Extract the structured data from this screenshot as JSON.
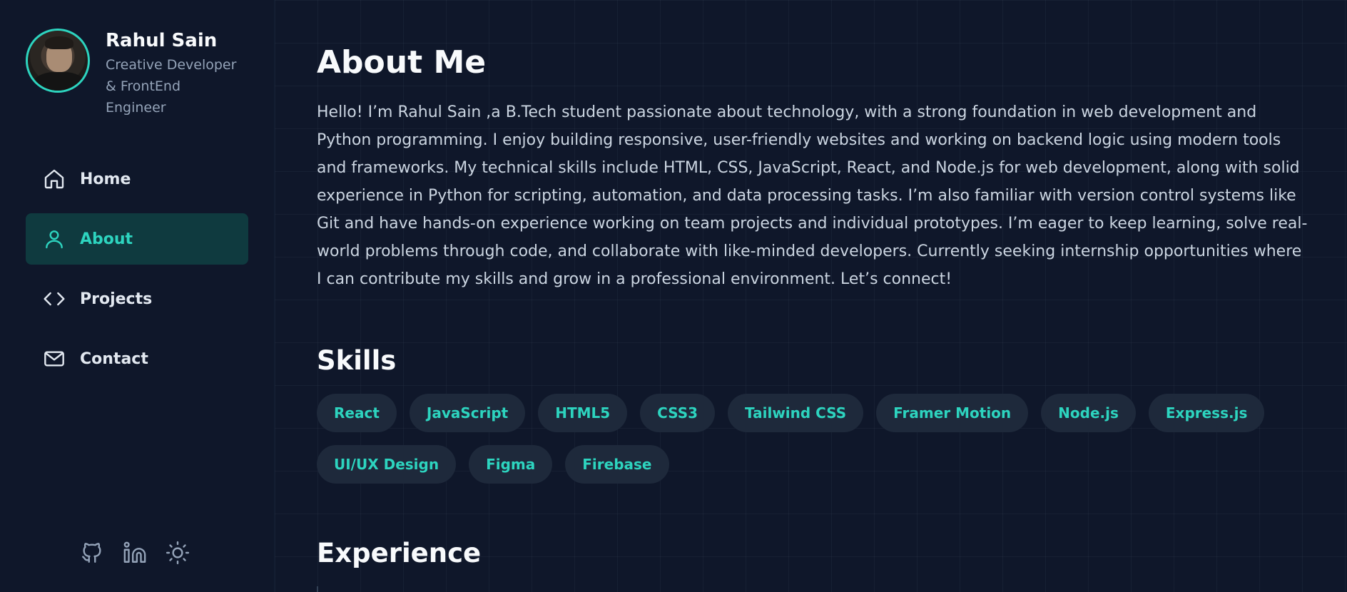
{
  "profile": {
    "name": "Rahul Sain",
    "role": "Creative Developer & FrontEnd Engineer"
  },
  "nav": {
    "items": [
      {
        "label": "Home",
        "icon": "home-icon",
        "active": false
      },
      {
        "label": "About",
        "icon": "user-icon",
        "active": true
      },
      {
        "label": "Projects",
        "icon": "code-icon",
        "active": false
      },
      {
        "label": "Contact",
        "icon": "mail-icon",
        "active": false
      }
    ]
  },
  "social": [
    "github-icon",
    "linkedin-icon",
    "sun-icon"
  ],
  "about": {
    "title": "About Me",
    "text": "Hello! I’m Rahul Sain ,a B.Tech student passionate about technology, with a strong foundation in web development and Python programming. I enjoy building responsive, user-friendly websites and working on backend logic using modern tools and frameworks. My technical skills include HTML, CSS, JavaScript, React, and Node.js for web development, along with solid experience in Python for scripting, automation, and data processing tasks. I’m also familiar with version control systems like Git and have hands-on experience working on team projects and individual prototypes. I’m eager to keep learning, solve real-world problems through code, and collaborate with like-minded developers. Currently seeking internship opportunities where I can contribute my skills and grow in a professional environment. Let’s connect!"
  },
  "skills": {
    "title": "Skills",
    "items": [
      "React",
      "JavaScript",
      "HTML5",
      "CSS3",
      "Tailwind CSS",
      "Framer Motion",
      "Node.js",
      "Express.js",
      "UI/UX Design",
      "Figma",
      "Firebase"
    ]
  },
  "experience": {
    "title": "Experience"
  },
  "colors": {
    "background": "#0f172a",
    "accent": "#2dd4bf",
    "chip_bg": "#1e293b",
    "active_nav_bg": "#0f3a3f"
  }
}
